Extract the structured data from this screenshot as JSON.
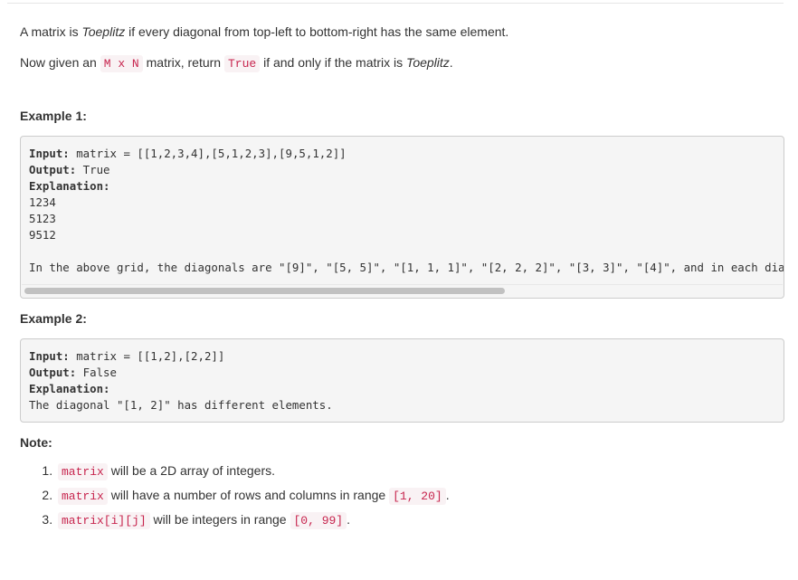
{
  "intro": {
    "line1_a": "A matrix is ",
    "line1_em": "Toeplitz",
    "line1_b": " if every diagonal from top-left to bottom-right has the same element.",
    "line2_a": "Now given an ",
    "line2_code1": "M x N",
    "line2_b": " matrix, return ",
    "line2_code2": "True",
    "line2_c": " if and only if the matrix is ",
    "line2_em": "Toeplitz",
    "line2_d": "."
  },
  "example1": {
    "heading": "Example 1:",
    "input_label": "Input:",
    "input_value": " matrix = [[1,2,3,4],[5,1,2,3],[9,5,1,2]]",
    "output_label": "Output:",
    "output_value": " True",
    "explanation_label": "Explanation:",
    "grid_rows": [
      "1234",
      "5123",
      "9512"
    ],
    "explanation_text": "In the above grid, the diagonals are \"[9]\", \"[5, 5]\", \"[1, 1, 1]\", \"[2, 2, 2]\", \"[3, 3]\", \"[4]\", and in each diagonal all elements are the same, so the answer is True."
  },
  "example2": {
    "heading": "Example 2:",
    "input_label": "Input:",
    "input_value": " matrix = [[1,2],[2,2]]",
    "output_label": "Output:",
    "output_value": " False",
    "explanation_label": "Explanation:",
    "explanation_text": "The diagonal \"[1, 2]\" has different elements."
  },
  "note": {
    "heading": "Note:",
    "items": [
      {
        "code": "matrix",
        "text": " will be a 2D array of integers.",
        "code2": "",
        "tail": ""
      },
      {
        "code": "matrix",
        "text": " will have a number of rows and columns in range ",
        "code2": "[1, 20]",
        "tail": "."
      },
      {
        "code": "matrix[i][j]",
        "text": " will be integers in range ",
        "code2": "[0, 99]",
        "tail": "."
      }
    ]
  }
}
